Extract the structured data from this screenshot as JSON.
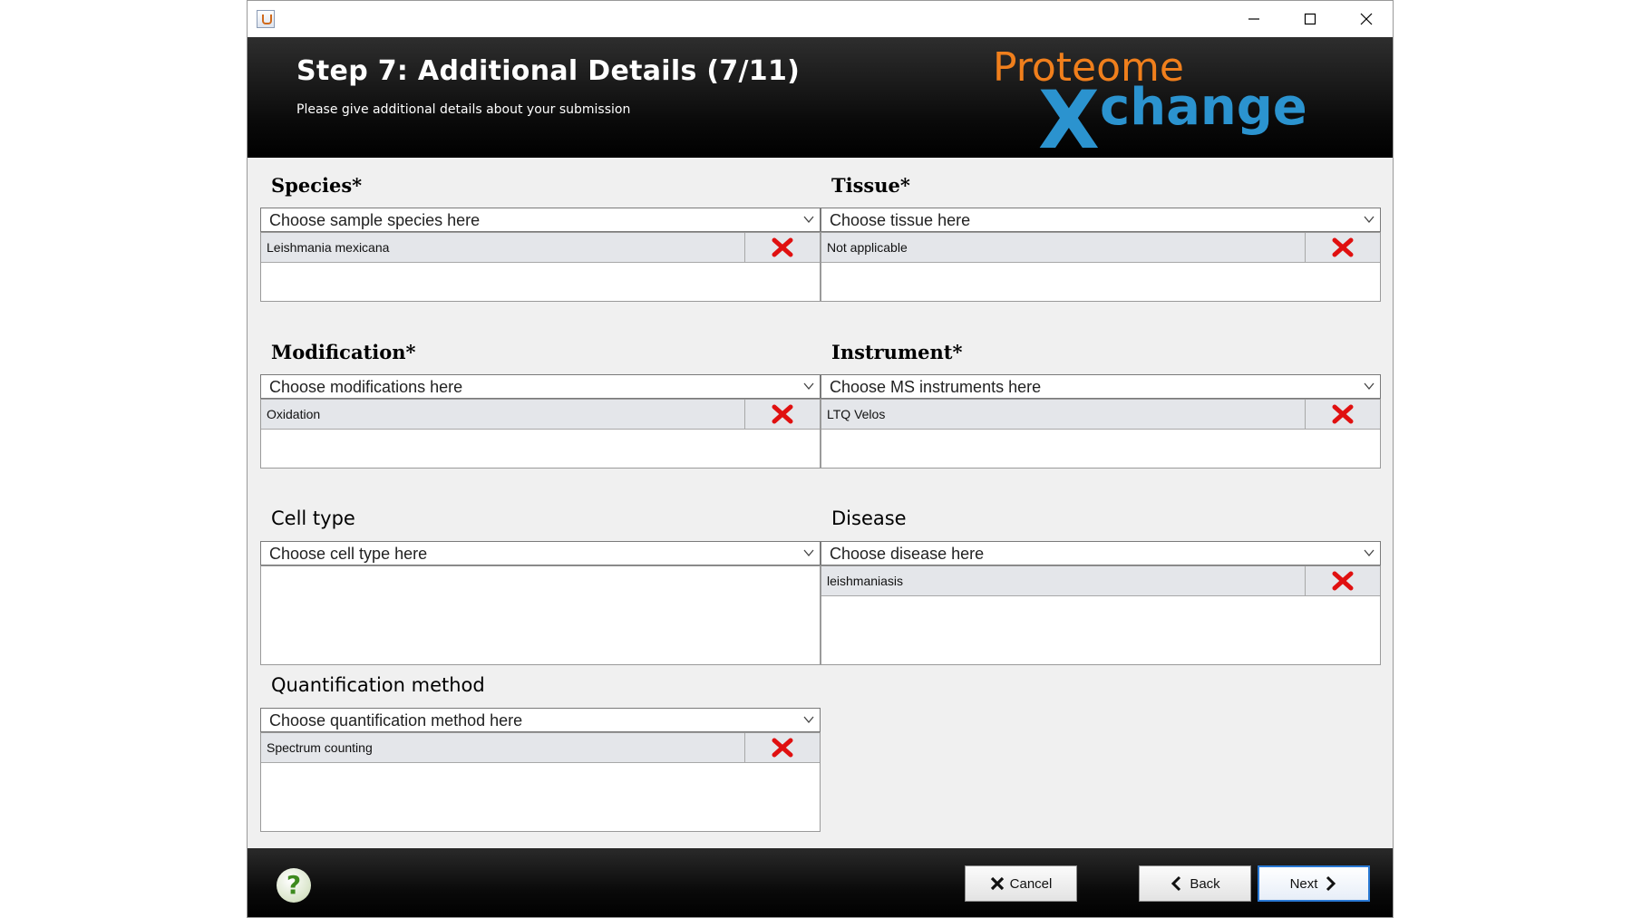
{
  "window": {
    "controls": {
      "minimize": "minimize-icon",
      "maximize": "maximize-icon",
      "close": "close-icon"
    }
  },
  "header": {
    "title": "Step 7: Additional Details (7/11)",
    "subtitle": "Please give additional details about your submission",
    "logo": {
      "line1": "Proteome",
      "line2": "change",
      "letter": "X"
    }
  },
  "sections": {
    "species": {
      "title": "Species*",
      "placeholder": "Choose sample species here",
      "items": [
        "Leishmania mexicana"
      ]
    },
    "tissue": {
      "title": "Tissue*",
      "placeholder": "Choose tissue here",
      "items": [
        "Not applicable"
      ]
    },
    "modification": {
      "title": "Modification*",
      "placeholder": "Choose modifications here",
      "items": [
        "Oxidation"
      ]
    },
    "instrument": {
      "title": "Instrument*",
      "placeholder": "Choose MS instruments here",
      "items": [
        "LTQ Velos"
      ]
    },
    "cell_type": {
      "title": "Cell type",
      "placeholder": "Choose cell type here",
      "items": []
    },
    "disease": {
      "title": "Disease",
      "placeholder": "Choose disease here",
      "items": [
        "leishmaniasis"
      ]
    },
    "quantification": {
      "title": "Quantification method",
      "placeholder": "Choose quantification method here",
      "items": [
        "Spectrum counting"
      ]
    }
  },
  "footer": {
    "help": "?",
    "cancel": "Cancel",
    "back": "Back",
    "next": "Next"
  },
  "colors": {
    "logo_orange": "#f07f1c",
    "logo_blue": "#2b93cf",
    "delete_red": "#e01010",
    "next_border": "#2a7ad5"
  }
}
